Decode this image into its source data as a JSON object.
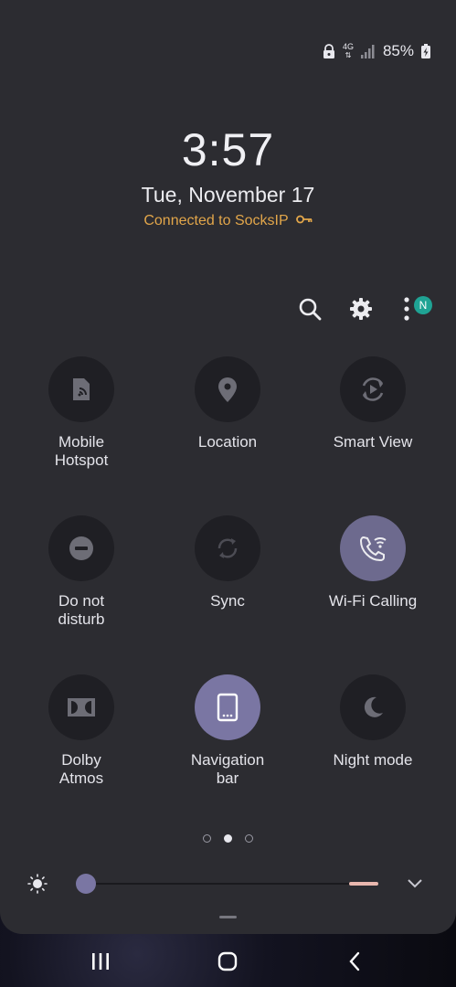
{
  "status_bar": {
    "network": "4G",
    "battery": "85%"
  },
  "lock": {
    "time": "3:57",
    "date": "Tue, November 17",
    "vpn_text": "Connected to SocksIP"
  },
  "toolbar": {
    "badge": "N"
  },
  "tiles": [
    {
      "label": "Mobile\nHotspot",
      "icon": "hotspot-icon",
      "state": "off"
    },
    {
      "label": "Location",
      "icon": "location-pin-icon",
      "state": "off"
    },
    {
      "label": "Smart View",
      "icon": "smart-view-icon",
      "state": "off"
    },
    {
      "label": "Do not\ndisturb",
      "icon": "do-not-disturb-icon",
      "state": "off"
    },
    {
      "label": "Sync",
      "icon": "sync-icon",
      "state": "off"
    },
    {
      "label": "Wi-Fi Calling",
      "icon": "wifi-calling-icon",
      "state": "on"
    },
    {
      "label": "Dolby\nAtmos",
      "icon": "dolby-icon",
      "state": "off"
    },
    {
      "label": "Navigation\nbar",
      "icon": "navigation-bar-icon",
      "state": "on"
    },
    {
      "label": "Night mode",
      "icon": "moon-icon",
      "state": "off"
    }
  ],
  "pager": {
    "count": 3,
    "active_index": 1
  },
  "brightness": {
    "level": 0.03
  },
  "colors": {
    "accent": "#7a76a3",
    "vpn_text": "#e2a64a",
    "badge": "#1fa394",
    "panel": "#2c2c31"
  }
}
